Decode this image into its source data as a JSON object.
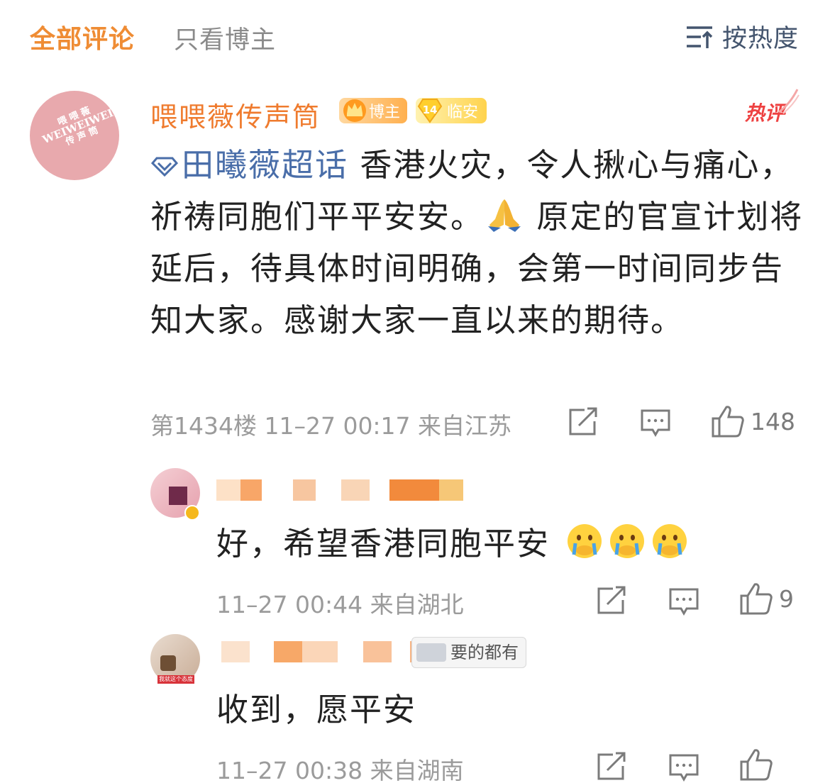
{
  "header": {
    "tab_all": "全部评论",
    "tab_blogger_only": "只看博主",
    "sort_label": "按热度",
    "sort_icon": "sort-lines-icon"
  },
  "comment": {
    "avatar_lines": [
      "喂 喂 薇",
      "WEIWEIWEI",
      "传 声 筒"
    ],
    "username": "喂喂薇传声筒",
    "badge_blogger": "博主",
    "badge_level": "14",
    "badge_city": "临安",
    "hot_label": "热评",
    "topic_label": "田曦薇超话",
    "text_part1": " 香港火灾，令人揪心与痛心，祈祷同胞们平平安安。",
    "text_part2": " 原定的官宣计划将延后，待具体时间明确，会第一时间同步告知大家。感谢大家一直以来的期待。",
    "meta": "第1434楼 11–27 00:17 来自江苏",
    "like_count": "148",
    "colors": {
      "username": "#ef7b2e",
      "topic": "#4a6ea9",
      "hot": "#ee4242",
      "tab_active": "#ef8c34"
    }
  },
  "replies": [
    {
      "text": "好，希望香港同胞平安",
      "emoji_count": 3,
      "meta": "11–27 00:44 来自湖北",
      "like_count": "9"
    },
    {
      "fan_badge": "要的都有",
      "avatar_caption": "我就这个态度",
      "text": "收到，愿平安",
      "meta": "11–27 00:38 来自湖南"
    }
  ]
}
